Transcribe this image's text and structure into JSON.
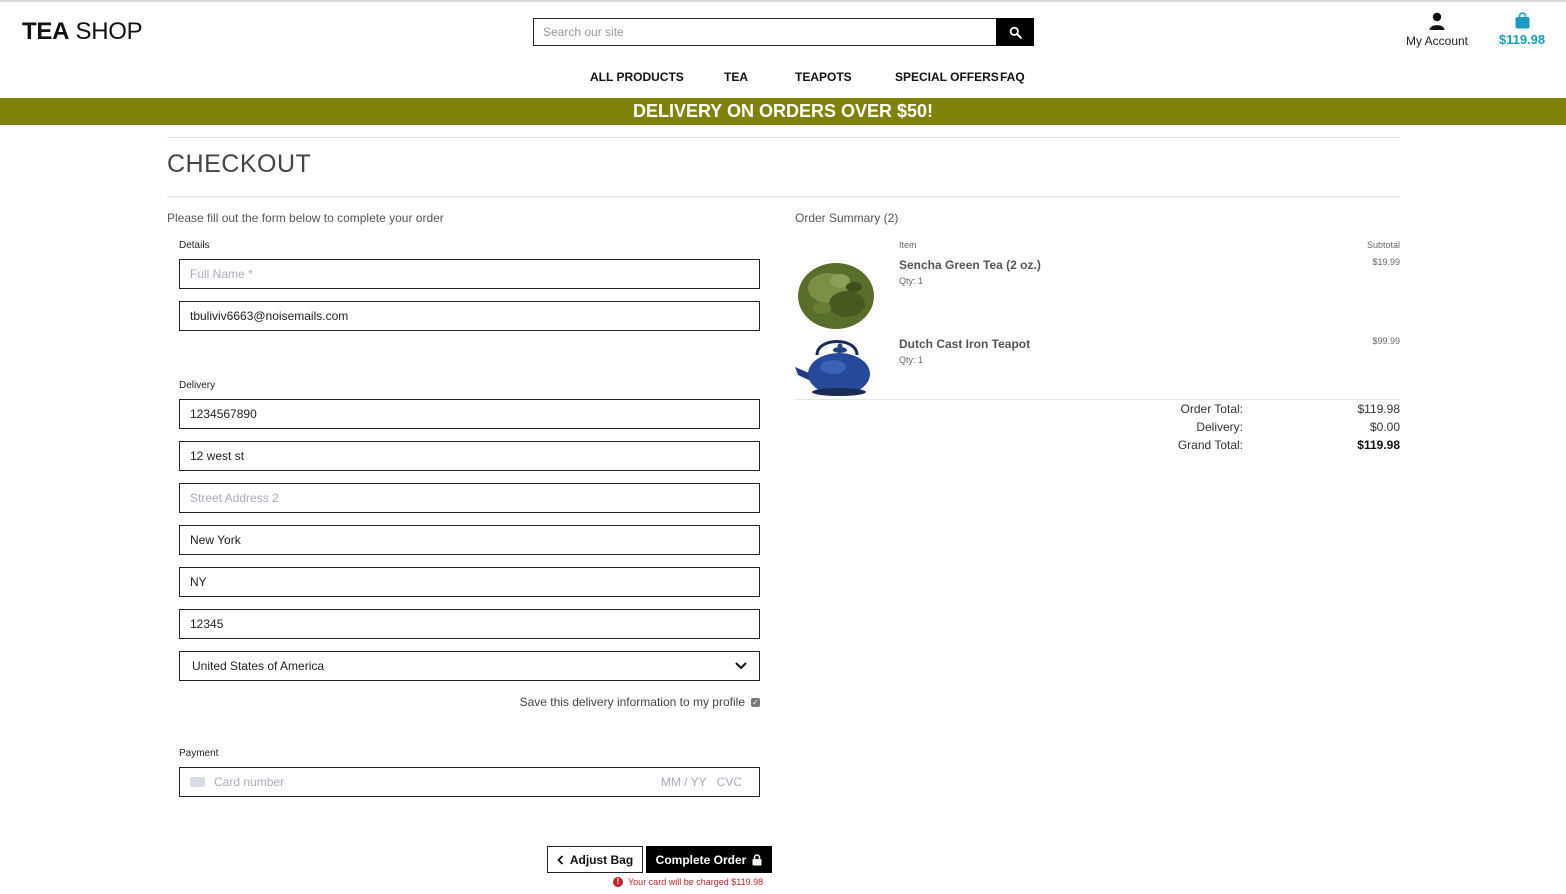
{
  "header": {
    "logo_bold": "TEA",
    "logo_rest": "SHOP",
    "search_placeholder": "Search our site",
    "account_label": "My Account",
    "bag_total": "$119.98"
  },
  "nav": [
    "ALL PRODUCTS",
    "TEA",
    "TEAPOTS",
    "SPECIAL OFFERS",
    "FAQ"
  ],
  "banner": "DELIVERY ON ORDERS OVER $50!",
  "page_title": "CHECKOUT",
  "form": {
    "intro": "Please fill out the form below to complete your order",
    "details_label": "Details",
    "full_name_placeholder": "Full Name *",
    "full_name_value": "",
    "email_value": "tbuliviv6663@noisemails.com",
    "delivery_label": "Delivery",
    "phone_value": "1234567890",
    "street1_value": "12 west st",
    "street2_placeholder": "Street Address 2",
    "town_value": "New York",
    "county_value": "NY",
    "postcode_value": "12345",
    "country_value": "United States of America",
    "save_info_label": "Save this delivery information to my profile",
    "save_info_checked": true,
    "payment_label": "Payment",
    "card_placeholder": "Card number",
    "card_expiry_placeholder": "MM / YY",
    "card_cvc_placeholder": "CVC"
  },
  "buttons": {
    "adjust_bag": "Adjust Bag",
    "complete_order": "Complete Order",
    "charge_warning": "Your card will be charged $119.98"
  },
  "summary": {
    "heading": "Order Summary (2)",
    "item_header": "Item",
    "subtotal_header": "Subtotal",
    "items": [
      {
        "name": "Sencha Green Tea (2 oz.)",
        "qty": "Qty: 1",
        "subtotal": "$19.99",
        "icon": "loose-tea-leaves"
      },
      {
        "name": "Dutch Cast Iron Teapot",
        "qty": "Qty: 1",
        "subtotal": "$99.99",
        "icon": "cast-iron-teapot"
      }
    ],
    "order_total_label": "Order Total:",
    "order_total": "$119.98",
    "delivery_label": "Delivery:",
    "delivery": "$0.00",
    "grand_total_label": "Grand Total:",
    "grand_total": "$119.98"
  },
  "colors": {
    "banner_bg": "#7f8208",
    "bag_accent": "#1b9bbf",
    "error": "#c0232b",
    "button_dark": "#000000"
  }
}
